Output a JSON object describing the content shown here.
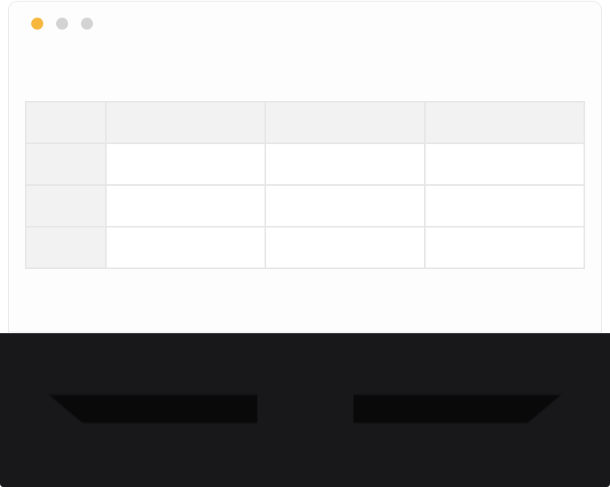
{
  "window": {
    "traffic_lights": [
      "active",
      "inactive",
      "inactive"
    ]
  },
  "spreadsheet": {
    "headers": [
      "",
      "",
      "",
      ""
    ],
    "rows": [
      {
        "header": "",
        "cells": [
          "",
          "",
          ""
        ]
      },
      {
        "header": "",
        "cells": [
          "",
          "",
          ""
        ]
      },
      {
        "header": "",
        "cells": [
          "",
          "",
          ""
        ]
      }
    ]
  }
}
